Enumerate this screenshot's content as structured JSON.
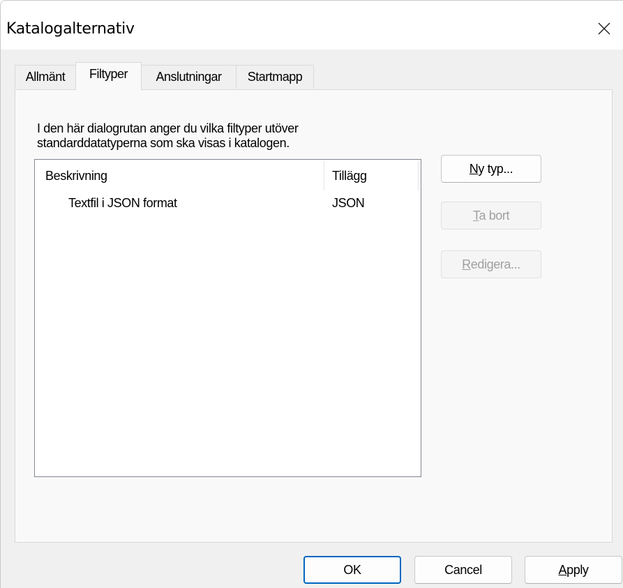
{
  "window": {
    "title": "Katalogalternativ",
    "close_label": "Close"
  },
  "tabs": [
    {
      "label": "Allmänt",
      "active": false
    },
    {
      "label": "Filtyper",
      "active": true
    },
    {
      "label": "Anslutningar",
      "active": false
    },
    {
      "label": "Startmapp",
      "active": false
    }
  ],
  "panel": {
    "description_line1": "I den här dialogrutan anger du vilka filtyper utöver",
    "description_line2": "standarddatatyperna som ska visas i katalogen."
  },
  "list": {
    "columns": [
      "Beskrivning",
      "Tillägg"
    ],
    "rows": [
      {
        "description": "Textfil i JSON format",
        "extension": "JSON"
      }
    ]
  },
  "side_buttons": {
    "new_type": {
      "accel": "N",
      "rest": "y typ...",
      "enabled": true
    },
    "remove": {
      "accel": "T",
      "rest": "a bort",
      "enabled": false
    },
    "edit": {
      "accel": "R",
      "rest": "edigera...",
      "enabled": false
    }
  },
  "footer": {
    "ok": "OK",
    "cancel": "Cancel",
    "apply_accel": "A",
    "apply_rest": "pply"
  },
  "colors": {
    "dialog_bg": "#f0f0f0",
    "panel_bg": "#f9f9f9",
    "default_button_border": "#0067c0",
    "disabled_text": "#a0a0a0"
  }
}
